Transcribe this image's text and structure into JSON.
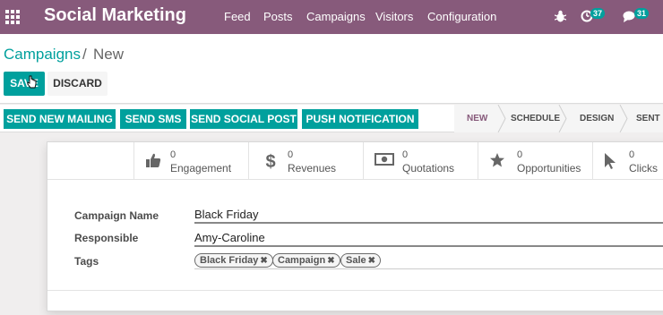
{
  "navbar": {
    "app_title": "Social Marketing",
    "menu": [
      "Feed",
      "Posts",
      "Campaigns",
      "Visitors",
      "Configuration"
    ],
    "activity_count": "37",
    "message_count": "31"
  },
  "breadcrumb": {
    "parent": "Campaigns",
    "separator": "/",
    "current": "New"
  },
  "toolbar": {
    "save_label": "SAVE",
    "discard_label": "DISCARD"
  },
  "actions": [
    "SEND NEW MAILING",
    "SEND SMS",
    "SEND SOCIAL POST",
    "PUSH NOTIFICATION"
  ],
  "stages": [
    "NEW",
    "SCHEDULE",
    "DESIGN",
    "SENT"
  ],
  "stats": [
    {
      "value": "0",
      "label": "Engagement",
      "icon": "thumbs-up-icon"
    },
    {
      "value": "0",
      "label": "Revenues",
      "icon": "dollar-icon"
    },
    {
      "value": "0",
      "label": "Quotations",
      "icon": "money-bill-icon"
    },
    {
      "value": "0",
      "label": "Opportunities",
      "icon": "star-icon"
    },
    {
      "value": "0",
      "label": "Clicks",
      "icon": "pointer-icon"
    }
  ],
  "form": {
    "campaign_name_label": "Campaign Name",
    "campaign_name": "Black Friday",
    "responsible_label": "Responsible",
    "responsible": "Amy-Caroline",
    "tags_label": "Tags",
    "tags": [
      "Black Friday",
      "Campaign",
      "Sale"
    ]
  },
  "colors": {
    "brand": "#875a7b",
    "accent": "#00a09d"
  }
}
